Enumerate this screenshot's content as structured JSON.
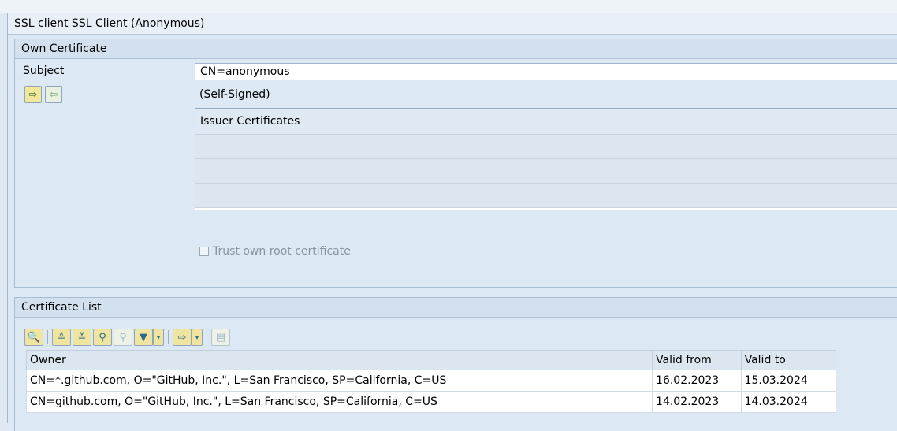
{
  "window": {
    "title": "SSL client SSL Client (Anonymous)"
  },
  "own_certificate": {
    "title": "Own Certificate",
    "subject_label": "Subject",
    "subject_value": "CN=anonymous",
    "self_signed": "(Self-Signed)",
    "issuer_header": "Issuer Certificates",
    "trust_label": "Trust own root certificate"
  },
  "certificate_list": {
    "title": "Certificate List",
    "columns": [
      "Owner",
      "Valid from",
      "Valid to"
    ],
    "rows": [
      {
        "owner": "CN=*.github.com, O=\"GitHub, Inc.\", L=San Francisco, SP=California, C=US",
        "valid_from": "16.02.2023",
        "valid_to": "15.03.2024"
      },
      {
        "owner": "CN=github.com, O=\"GitHub, Inc.\", L=San Francisco, SP=California, C=US",
        "valid_from": "14.02.2023",
        "valid_to": "14.03.2024"
      }
    ]
  },
  "icons": {
    "import": "import-icon",
    "export": "export-icon",
    "details": "details-icon",
    "sort_ascending": "sort-ascending-icon",
    "sort_descending": "sort-descending-icon",
    "find": "find-icon",
    "find_next": "find-next-icon",
    "filter": "filter-icon",
    "export_list": "export-list-icon",
    "layout": "layout-icon"
  }
}
